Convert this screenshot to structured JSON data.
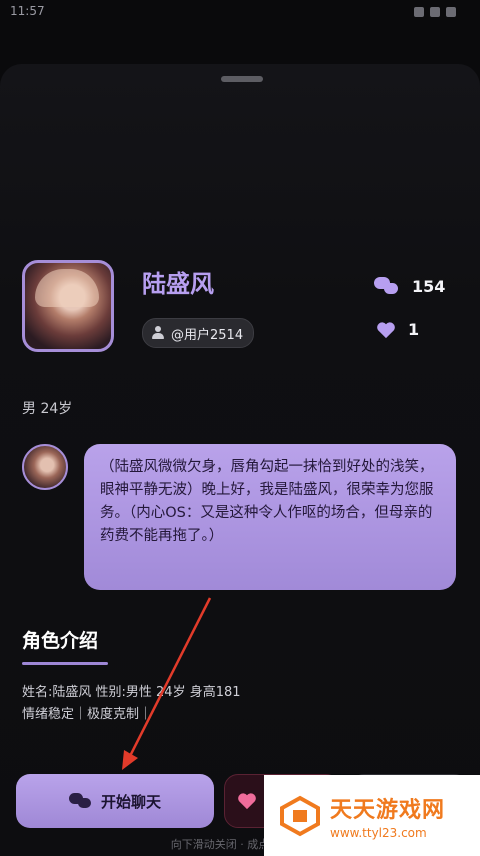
{
  "status_bar": {
    "time": "11:57"
  },
  "profile": {
    "name": "陆盛风",
    "user_tag": "@用户2514",
    "chat_count": "154",
    "like_count": "1",
    "gender_age": "男 24岁"
  },
  "message": {
    "text": "（陆盛风微微欠身，唇角勾起一抹恰到好处的浅笑，眼神平静无波）晚上好，我是陆盛风，很荣幸为您服务。（内心OS：又是这种令人作呕的场合，但母亲的药费不能再拖了。）"
  },
  "intro": {
    "title": "角色介绍",
    "line1": "姓名:陆盛风 性别:男性 24岁 身高181",
    "line2": "情绪稳定｜极度克制｜"
  },
  "actions": {
    "start_chat": "开始聊天"
  },
  "hint": "向下滑动关闭 · 成点",
  "watermark": {
    "title": "天天游戏网",
    "url": "www.ttyl23.com"
  },
  "colors": {
    "accent": "#b79ff0",
    "bubble": "#ad96e2",
    "fav": "#f06c9b",
    "watermark": "#f07a1e"
  }
}
